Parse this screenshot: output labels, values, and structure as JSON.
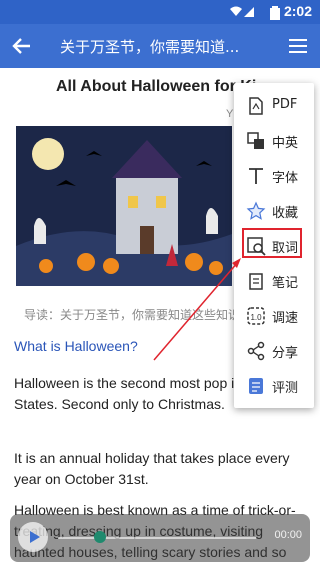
{
  "status_bar": {
    "time": "2:02"
  },
  "app_bar": {
    "title": "关于万圣节，你需要知道..."
  },
  "article": {
    "title": "All About Halloween for Ki",
    "title_fragment": "Y",
    "caption": "导读：关于万圣节，你需要知道这些知识",
    "section_heading": "What is Halloween?",
    "paragraphs": [
      "Halloween is the second most pop in the United States. Second only to Christmas.",
      "It is an annual holiday that takes place every year on October 31st.",
      "Halloween is best known as a time of trick-or-treating, dressing up in costume, visiting haunted houses, telling scary stories and so"
    ]
  },
  "player": {
    "time": "00:00"
  },
  "menu": {
    "items": [
      {
        "label": "PDF",
        "icon": "pdf-icon"
      },
      {
        "label": "中英",
        "icon": "translate-icon"
      },
      {
        "label": "字体",
        "icon": "font-icon"
      },
      {
        "label": "收藏",
        "icon": "star-icon"
      },
      {
        "label": "取词",
        "icon": "word-lookup-icon"
      },
      {
        "label": "笔记",
        "icon": "note-icon"
      },
      {
        "label": "调速",
        "icon": "speed-icon"
      },
      {
        "label": "分享",
        "icon": "share-icon"
      },
      {
        "label": "评测",
        "icon": "evaluate-icon"
      }
    ],
    "highlighted_item": "取词"
  },
  "colors": {
    "header": "#3c6fd0",
    "link": "#2a55b8",
    "highlight": "#e0242e",
    "player_knob": "#1f8a6e"
  }
}
